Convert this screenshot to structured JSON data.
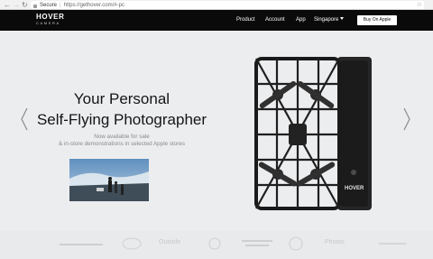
{
  "browser": {
    "secure_label": "Secure",
    "url_separator": "|",
    "url": "https://gethover.com/#-pc"
  },
  "site": {
    "logo_main": "HOVER",
    "logo_sub": "CAMERA",
    "menu": [
      "Product",
      "Account",
      "App",
      "Singapore"
    ],
    "buy_label": "Buy On Apple"
  },
  "hero": {
    "headline_line1": "Your Personal",
    "headline_line2": "Self-Flying Photographer",
    "sub_line1": "Now available for sale",
    "sub_line2": "& in-store demonstrations in selected Apple stores"
  },
  "partner_logos": [
    "Outside",
    "Photos"
  ],
  "colors": {
    "header_bg": "#0a0a0a",
    "hero_bg": "#ecedef",
    "accent": "#ffffff"
  }
}
